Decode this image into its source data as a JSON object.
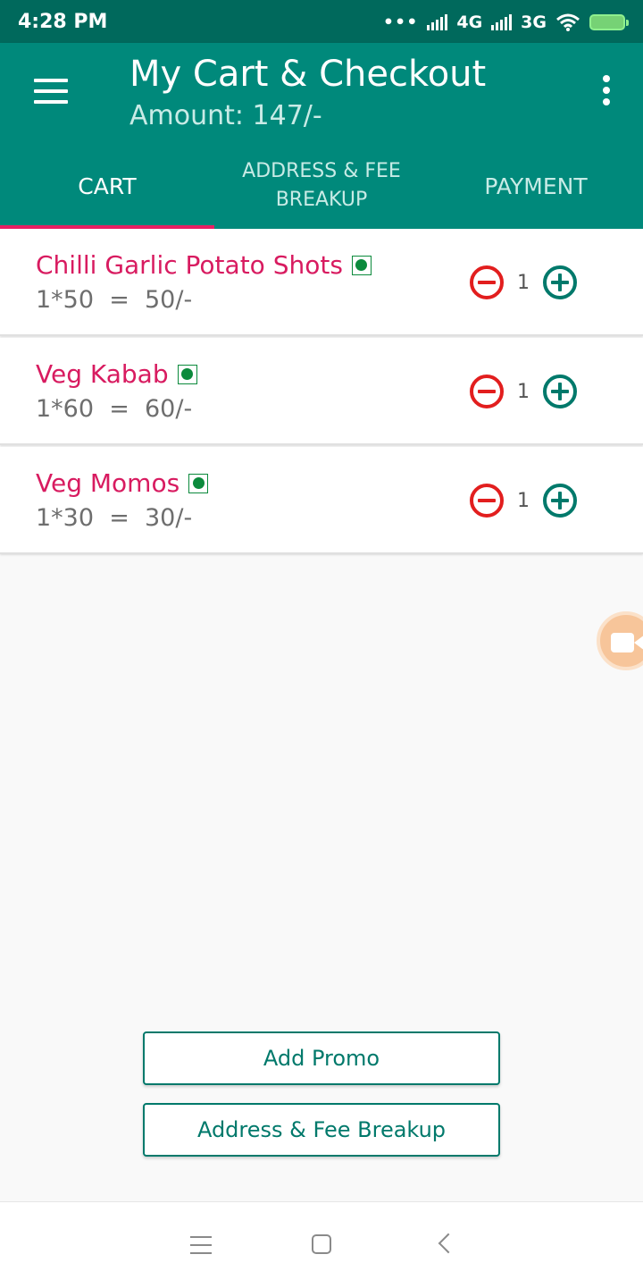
{
  "status_bar": {
    "time": "4:28 PM",
    "dots": "•••",
    "network_1": "4G",
    "network_2": "3G",
    "icons": [
      "signal-icon",
      "signal-icon",
      "wifi-icon",
      "battery-charging-icon"
    ]
  },
  "app_bar": {
    "title": "My Cart & Checkout",
    "subtitle": "Amount: 147/-",
    "icons": [
      "hamburger-menu-icon",
      "more-vert-icon"
    ]
  },
  "tabs": [
    {
      "label": "CART",
      "active": true
    },
    {
      "label": "ADDRESS & FEE BREAKUP",
      "active": false
    },
    {
      "label": "PAYMENT",
      "active": false
    }
  ],
  "cart_items": [
    {
      "name": "Chilli Garlic Potato Shots",
      "calc": "1*50  =  50/-",
      "qty": "1",
      "veg": true
    },
    {
      "name": "Veg Kabab",
      "calc": "1*60  =  60/-",
      "qty": "1",
      "veg": true
    },
    {
      "name": "Veg Momos",
      "calc": "1*30  =  30/-",
      "qty": "1",
      "veg": true
    }
  ],
  "buttons": {
    "promo": "Add Promo",
    "address": "Address & Fee Breakup"
  },
  "colors": {
    "status_bar": "#00695c",
    "primary": "#00897b",
    "accent": "#e91e63",
    "item_name": "#d81b60",
    "minus": "#e21e1e",
    "plus": "#00796b",
    "veg": "#0b8a3c"
  }
}
